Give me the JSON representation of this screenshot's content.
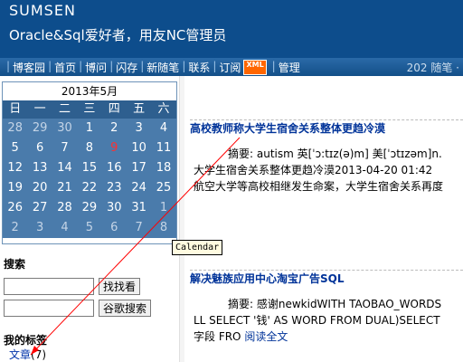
{
  "header": {
    "title": "SUMSEN",
    "subtitle": "Oracle&Sql爱好者，用友NC管理员"
  },
  "nav": {
    "items": [
      {
        "label": "博客园"
      },
      {
        "label": "首页"
      },
      {
        "label": "博问"
      },
      {
        "label": "闪存"
      },
      {
        "label": "新随笔"
      },
      {
        "label": "联系"
      },
      {
        "label": "订阅"
      },
      {
        "label": "管理"
      }
    ],
    "xml_badge": "XML",
    "post_count": "202 随笔 ·"
  },
  "calendar": {
    "title": "2013年5月",
    "weekdays": [
      "日",
      "一",
      "二",
      "三",
      "四",
      "五",
      "六"
    ],
    "weeks": [
      [
        "28",
        "29",
        "30",
        "1",
        "2",
        "3",
        "4"
      ],
      [
        "5",
        "6",
        "7",
        "8",
        "9",
        "10",
        "11"
      ],
      [
        "12",
        "13",
        "14",
        "15",
        "16",
        "17",
        "18"
      ],
      [
        "19",
        "20",
        "21",
        "22",
        "23",
        "24",
        "25"
      ],
      [
        "26",
        "27",
        "28",
        "29",
        "30",
        "31",
        "1"
      ],
      [
        "2",
        "3",
        "4",
        "5",
        "6",
        "7",
        "8"
      ]
    ],
    "tooltip": "Calendar",
    "highlight_color": "#ff3030"
  },
  "search": {
    "heading": "搜索",
    "button1": "找找看",
    "button2": "谷歌搜索"
  },
  "tags": {
    "heading": "我的标签",
    "item_label": "文章",
    "item_count": "(7)"
  },
  "posts": [
    {
      "title": "高校教师称大学生宿舍关系整体更趋冷漠",
      "summary_line1": "摘要: autism 英[ˈɔ:tɪz(ə)m] 美[ˈɔtɪzəm]n.",
      "summary_line2": "大学生宿舍关系整体更趋冷漠2013-04-20 01:42",
      "summary_line3": "航空大学等高校相继发生命案，大学生宿舍关系再度"
    },
    {
      "title": "解决魅族应用中心淘宝广告SQL",
      "summary_line1": "摘要: 感谢newkidWITH TAOBAO_WORDS",
      "summary_line2": "LL SELECT '钱' AS WORD FROM DUAL)SELECT",
      "summary_line3": "字段 FRO",
      "read_more": "阅读全文"
    }
  ],
  "colors": {
    "header_bg": "#0d4d8c",
    "calendar_bg": "#4a7bab",
    "link": "#003399",
    "annotation": "#ff0000"
  }
}
